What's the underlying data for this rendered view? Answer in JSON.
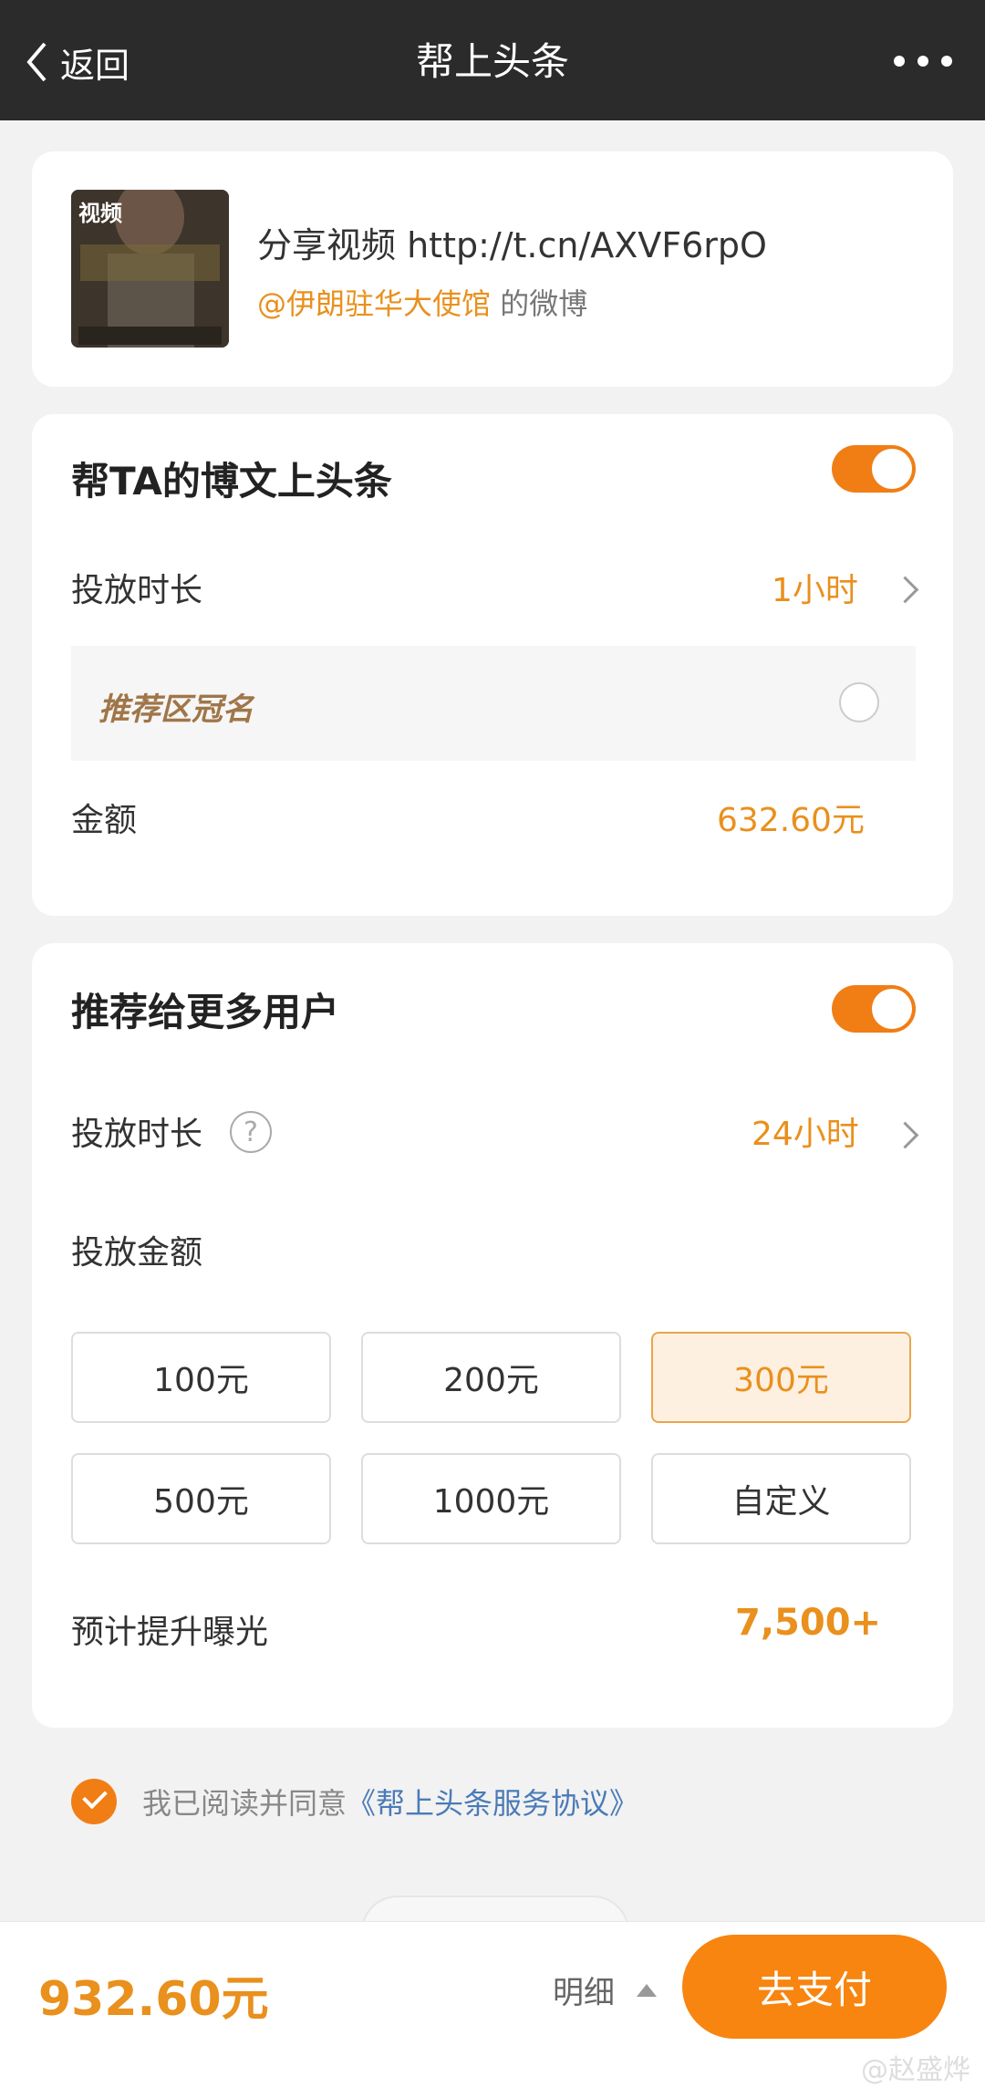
{
  "header": {
    "back_label": "返回",
    "title": "帮上头条"
  },
  "post": {
    "thumb_tag": "视频",
    "share_text": "分享视频 http://t.cn/AXVF6rpO",
    "author": "@伊朗驻华大使馆",
    "author_suffix": " 的微博"
  },
  "headline_section": {
    "title": "帮TA的博文上头条",
    "toggle_on": true,
    "duration_label": "投放时长",
    "duration_value": "1小时",
    "sponsor_label": "推荐区冠名",
    "amount_label": "金额",
    "amount_value": "632.60元"
  },
  "recommend_section": {
    "title": "推荐给更多用户",
    "toggle_on": true,
    "duration_label": "投放时长",
    "help_icon": "?",
    "duration_value": "24小时",
    "amount_label": "投放金额",
    "options": [
      "100元",
      "200元",
      "300元",
      "500元",
      "1000元",
      "自定义"
    ],
    "selected_option": "300元",
    "exposure_label": "预计提升曝光",
    "exposure_value": "7,500+"
  },
  "agreement": {
    "checked": true,
    "prefix": "我已阅读并同意",
    "link": "《帮上头条服务协议》"
  },
  "footer": {
    "total": "932.60元",
    "detail_label": "明细",
    "pay_label": "去支付"
  },
  "watermark": "@赵盛烨",
  "colors": {
    "accent": "#f07e15",
    "accent_text": "#e9901d",
    "header_bg": "#2b2b2b",
    "link": "#4a7bb7"
  }
}
